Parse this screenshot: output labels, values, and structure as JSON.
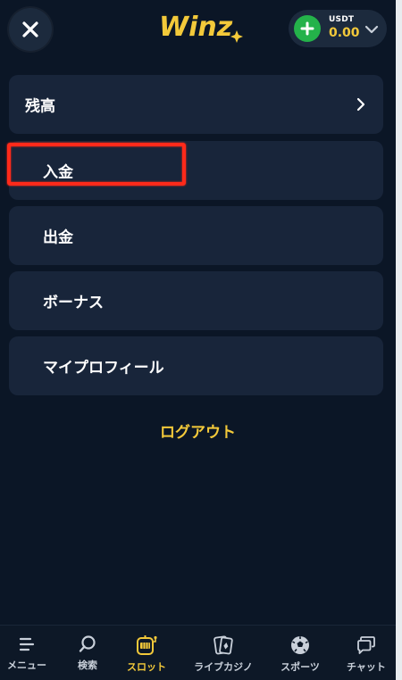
{
  "header": {
    "logo_text": "Winz",
    "wallet": {
      "currency": "USDT",
      "balance": "0.00"
    }
  },
  "menu": {
    "items": [
      {
        "label": "残高"
      },
      {
        "label": "入金"
      },
      {
        "label": "出金"
      },
      {
        "label": "ボーナス"
      },
      {
        "label": "マイプロフィール"
      }
    ],
    "logout": "ログアウト"
  },
  "bottom_nav": {
    "items": [
      {
        "label": "メニュー",
        "icon": "menu-icon"
      },
      {
        "label": "検索",
        "icon": "search-icon"
      },
      {
        "label": "スロット",
        "icon": "slot-machine-icon",
        "active": true
      },
      {
        "label": "ライブカジノ",
        "icon": "cards-icon"
      },
      {
        "label": "スポーツ",
        "icon": "soccer-ball-icon"
      },
      {
        "label": "チャット",
        "icon": "chat-icon"
      }
    ]
  },
  "colors": {
    "background": "#0b1626",
    "card": "#18253a",
    "accent": "#f3c93a",
    "plus_button": "#24b24a",
    "highlight": "#ff2a1a"
  }
}
